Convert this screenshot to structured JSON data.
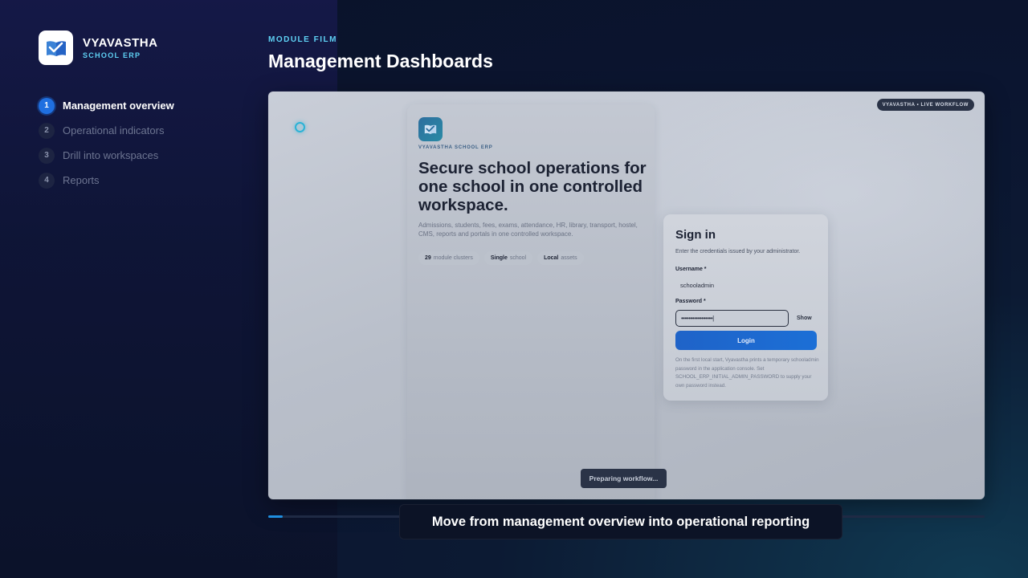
{
  "brand": {
    "name": "VYAVASTHA",
    "subtitle": "SCHOOL ERP"
  },
  "steps": [
    {
      "num": "1",
      "label": "Management overview",
      "active": true
    },
    {
      "num": "2",
      "label": "Operational indicators",
      "active": false
    },
    {
      "num": "3",
      "label": "Drill into workspaces",
      "active": false
    },
    {
      "num": "4",
      "label": "Reports",
      "active": false
    }
  ],
  "header": {
    "tag": "MODULE FILM",
    "title": "Management Dashboards"
  },
  "screen": {
    "live_badge": "VYAVASTHA • LIVE WORKFLOW",
    "hero": {
      "kicker": "VYAVASTHA SCHOOL ERP",
      "title": "Secure school operations for one school in one controlled workspace.",
      "description": "Admissions, students, fees, exams, attendance, HR, library, transport, hostel, CMS, reports and portals in one controlled workspace.",
      "chips": [
        {
          "strong": "29",
          "text": "module clusters"
        },
        {
          "strong": "Single",
          "text": "school"
        },
        {
          "strong": "Local",
          "text": "assets"
        }
      ]
    },
    "signin": {
      "title": "Sign in",
      "subtitle": "Enter the credentials issued by your administrator.",
      "username_label": "Username *",
      "username_value": "schooladmin",
      "password_label": "Password *",
      "password_value": "•••••••••••••••••|",
      "show_label": "Show",
      "login_label": "Login",
      "note": "On the first local start, Vyavastha prints a temporary schooladmin password in the application console. Set SCHOOL_ERP_INITIAL_ADMIN_PASSWORD to supply your own password instead."
    },
    "status": "Preparing workflow..."
  },
  "progress": {
    "percent": 2
  },
  "caption": "Move from management overview into operational reporting",
  "colors": {
    "accent": "#5fd2f5",
    "primary": "#1f6fe0",
    "background": "#0b1530"
  },
  "icons": {
    "brand": "open-book-check-icon"
  }
}
